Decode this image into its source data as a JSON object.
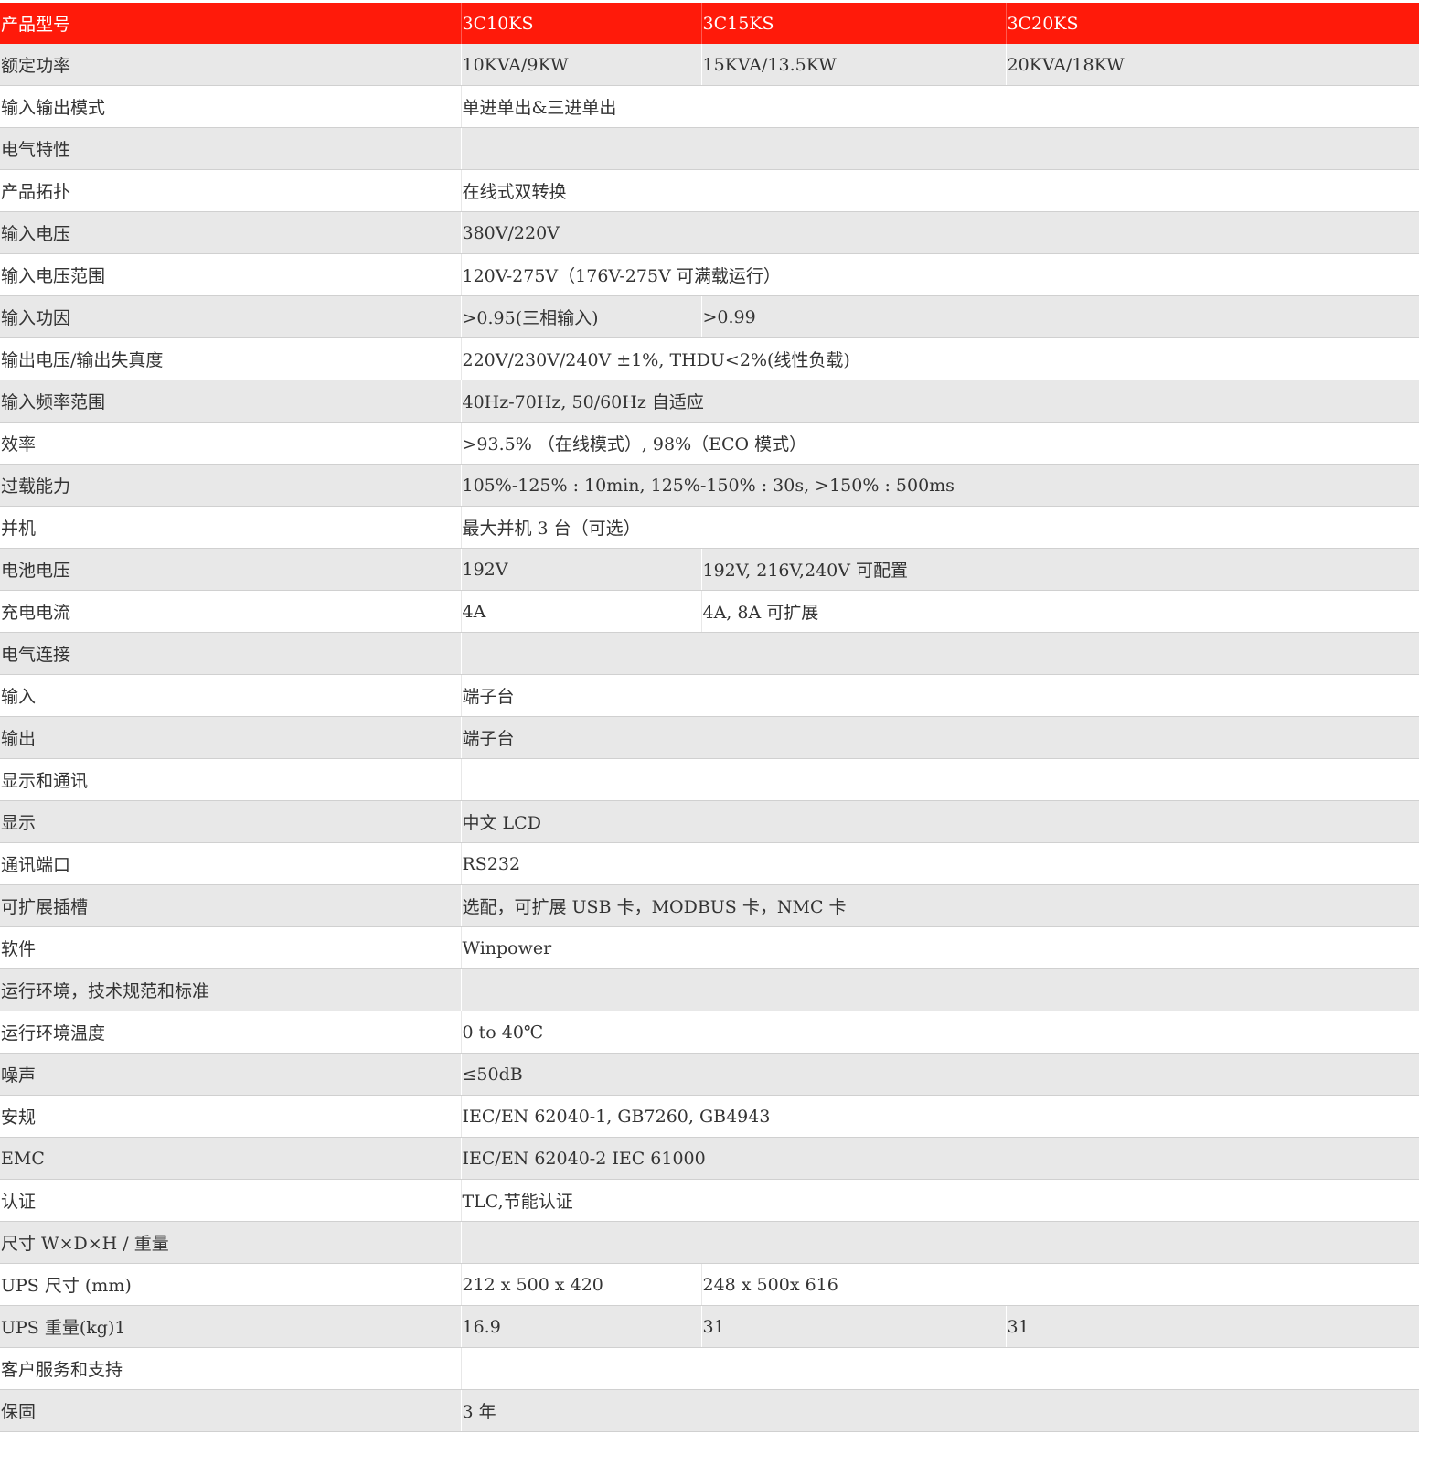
{
  "table": {
    "header": [
      "产品型号",
      "3C10KS",
      "3C15KS",
      "3C20KS"
    ],
    "rows": [
      {
        "cells": [
          "额定功率",
          "10KVA/9KW",
          "15KVA/13.5KW",
          "20KVA/18KW"
        ],
        "spans": [
          1,
          1,
          1,
          1
        ]
      },
      {
        "cells": [
          "输入输出模式",
          "单进单出&三进单出"
        ],
        "spans": [
          1,
          3
        ]
      },
      {
        "cells": [
          "电气特性",
          ""
        ],
        "spans": [
          1,
          3
        ]
      },
      {
        "cells": [
          "产品拓扑",
          "在线式双转换"
        ],
        "spans": [
          1,
          3
        ]
      },
      {
        "cells": [
          "输入电压",
          "380V/220V"
        ],
        "spans": [
          1,
          3
        ]
      },
      {
        "cells": [
          "输入电压范围",
          "120V-275V（176V-275V 可满载运行）"
        ],
        "spans": [
          1,
          3
        ]
      },
      {
        "cells": [
          "输入功因",
          ">0.95(三相输入)",
          ">0.99"
        ],
        "spans": [
          1,
          1,
          2
        ]
      },
      {
        "cells": [
          "输出电压/输出失真度",
          "220V/230V/240V ±1%, THDU<2%(线性负载)"
        ],
        "spans": [
          1,
          3
        ]
      },
      {
        "cells": [
          "输入频率范围",
          "40Hz-70Hz, 50/60Hz 自适应"
        ],
        "spans": [
          1,
          3
        ]
      },
      {
        "cells": [
          "效率",
          ">93.5% （在线模式）, 98%（ECO 模式）"
        ],
        "spans": [
          1,
          3
        ]
      },
      {
        "cells": [
          "过载能力",
          "105%-125% : 10min, 125%-150% : 30s, >150% : 500ms"
        ],
        "spans": [
          1,
          3
        ]
      },
      {
        "cells": [
          "并机",
          "最大并机 3 台（可选）"
        ],
        "spans": [
          1,
          3
        ]
      },
      {
        "cells": [
          "电池电压",
          "192V",
          "192V, 216V,240V 可配置"
        ],
        "spans": [
          1,
          1,
          2
        ]
      },
      {
        "cells": [
          "充电电流",
          "4A",
          "4A, 8A 可扩展"
        ],
        "spans": [
          1,
          1,
          2
        ]
      },
      {
        "cells": [
          "电气连接",
          ""
        ],
        "spans": [
          1,
          3
        ]
      },
      {
        "cells": [
          "输入",
          "端子台"
        ],
        "spans": [
          1,
          3
        ]
      },
      {
        "cells": [
          "输出",
          "端子台"
        ],
        "spans": [
          1,
          3
        ]
      },
      {
        "cells": [
          "显示和通讯",
          ""
        ],
        "spans": [
          1,
          3
        ]
      },
      {
        "cells": [
          "显示",
          "中文 LCD"
        ],
        "spans": [
          1,
          3
        ]
      },
      {
        "cells": [
          "通讯端口",
          "RS232"
        ],
        "spans": [
          1,
          3
        ]
      },
      {
        "cells": [
          "可扩展插槽",
          "选配，可扩展 USB 卡，MODBUS 卡，NMC 卡"
        ],
        "spans": [
          1,
          3
        ]
      },
      {
        "cells": [
          "软件",
          "Winpower"
        ],
        "spans": [
          1,
          3
        ]
      },
      {
        "cells": [
          "运行环境，技术规范和标准",
          ""
        ],
        "spans": [
          1,
          3
        ]
      },
      {
        "cells": [
          "运行环境温度",
          "0 to 40℃"
        ],
        "spans": [
          1,
          3
        ]
      },
      {
        "cells": [
          "噪声",
          "≤50dB"
        ],
        "spans": [
          1,
          3
        ]
      },
      {
        "cells": [
          "安规",
          "IEC/EN 62040-1, GB7260, GB4943"
        ],
        "spans": [
          1,
          3
        ]
      },
      {
        "cells": [
          "EMC",
          "IEC/EN 62040-2 IEC 61000"
        ],
        "spans": [
          1,
          3
        ]
      },
      {
        "cells": [
          "认证",
          "TLC,节能认证"
        ],
        "spans": [
          1,
          3
        ]
      },
      {
        "cells": [
          "尺寸 W×D×H / 重量",
          ""
        ],
        "spans": [
          1,
          3
        ]
      },
      {
        "cells": [
          "UPS 尺寸 (mm)",
          "212 x 500 x 420",
          "248 x 500x 616"
        ],
        "spans": [
          1,
          1,
          2
        ]
      },
      {
        "cells": [
          "UPS 重量(kg)1",
          "16.9",
          "31",
          "31"
        ],
        "spans": [
          1,
          1,
          1,
          1
        ]
      },
      {
        "cells": [
          "客户服务和支持",
          ""
        ],
        "spans": [
          1,
          3
        ]
      },
      {
        "cells": [
          "保固",
          "3 年"
        ],
        "spans": [
          1,
          3
        ]
      }
    ]
  }
}
